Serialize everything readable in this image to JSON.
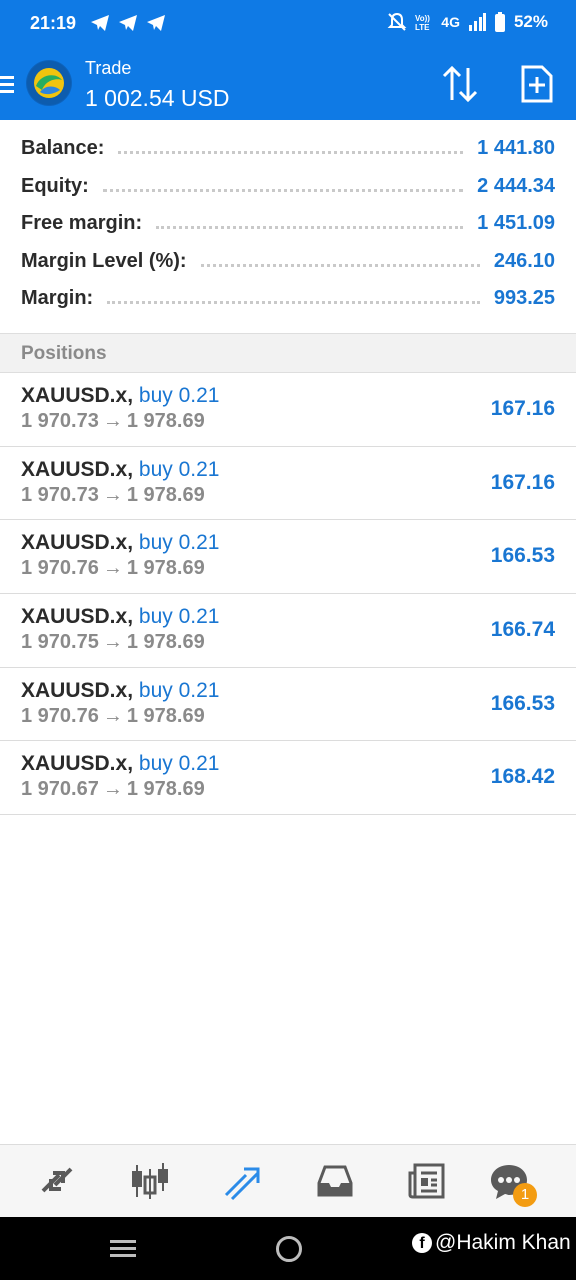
{
  "status_bar": {
    "time": "21:19",
    "network": "4G",
    "battery": "52%"
  },
  "header": {
    "title": "Trade",
    "balance": "1 002.54 USD"
  },
  "summary": [
    {
      "label": "Balance:",
      "value": "1 441.80"
    },
    {
      "label": "Equity:",
      "value": "2 444.34"
    },
    {
      "label": "Free margin:",
      "value": "1 451.09"
    },
    {
      "label": "Margin Level (%):",
      "value": "246.10"
    },
    {
      "label": "Margin:",
      "value": "993.25"
    }
  ],
  "positions_title": "Positions",
  "positions": [
    {
      "symbol": "XAUUSD.x",
      "side": "buy 0.21",
      "open": "1 970.73",
      "current": "1 978.69",
      "profit": "167.16"
    },
    {
      "symbol": "XAUUSD.x",
      "side": "buy 0.21",
      "open": "1 970.73",
      "current": "1 978.69",
      "profit": "167.16"
    },
    {
      "symbol": "XAUUSD.x",
      "side": "buy 0.21",
      "open": "1 970.76",
      "current": "1 978.69",
      "profit": "166.53"
    },
    {
      "symbol": "XAUUSD.x",
      "side": "buy 0.21",
      "open": "1 970.75",
      "current": "1 978.69",
      "profit": "166.74"
    },
    {
      "symbol": "XAUUSD.x",
      "side": "buy 0.21",
      "open": "1 970.76",
      "current": "1 978.69",
      "profit": "166.53"
    },
    {
      "symbol": "XAUUSD.x",
      "side": "buy 0.21",
      "open": "1 970.67",
      "current": "1 978.69",
      "profit": "168.42"
    }
  ],
  "arrow": "→",
  "comma": ",",
  "bottom_nav": {
    "items": [
      "quotes-icon",
      "chart-icon",
      "trade-icon",
      "history-icon",
      "news-icon",
      "messages-icon"
    ],
    "active": "trade-icon",
    "messages_badge": "1"
  },
  "watermark": {
    "fb": "f",
    "text": "@Hakim Khan"
  },
  "colors": {
    "header_blue": "#0f7ae5",
    "value_blue": "#1976d2",
    "badge_orange": "#f39c12"
  }
}
